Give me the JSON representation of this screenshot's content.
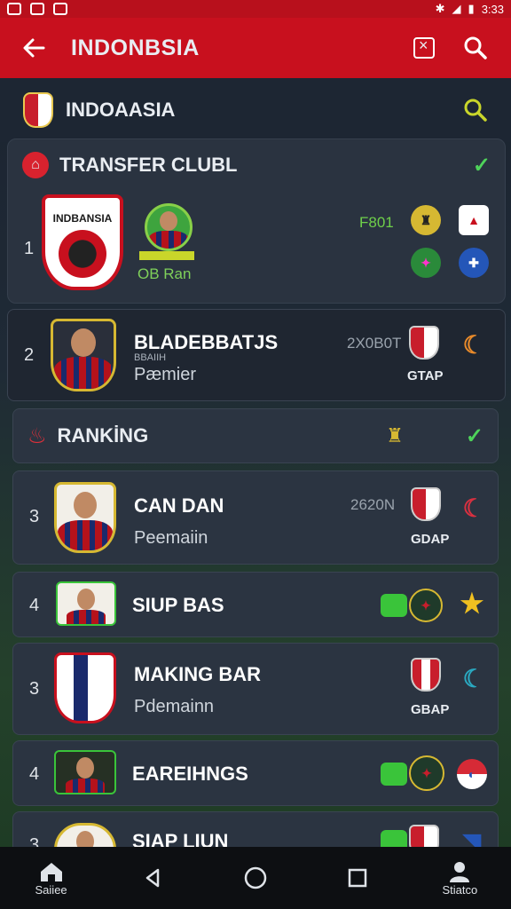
{
  "status_bar": {
    "time": "3:33"
  },
  "app_bar": {
    "title": "INDONBSIA"
  },
  "sub_header": {
    "team_name": "INDOAASIA"
  },
  "transfer_section": {
    "title": "TRANSFER CLUBL",
    "entries": [
      {
        "rank": "1",
        "crest_text": "INDBANSIA",
        "caption": "OB Ran",
        "points": "F801"
      },
      {
        "rank": "2",
        "name": "BLADEBBATJS",
        "small": "BBAIIH",
        "position": "Pæmier",
        "points": "2X0B0T",
        "label": "GTAP"
      }
    ]
  },
  "ranking_section": {
    "title": "RANKİNG",
    "entries": [
      {
        "rank": "3",
        "name": "CAN DAN",
        "position": "Peemaiin",
        "points": "2620N",
        "label": "GDAP"
      },
      {
        "rank": "4",
        "name": "SIUP BAS"
      },
      {
        "rank": "3",
        "name": "MAKING BAR",
        "position": "Pdemainn",
        "label": "GBAP"
      },
      {
        "rank": "4",
        "name": "EAREIHNGS"
      },
      {
        "rank": "3",
        "name": "SIAP LIUN"
      }
    ]
  },
  "bottom_nav": {
    "left_label": "Saiiee",
    "right_label": "Stiatco"
  },
  "colors": {
    "brand_red": "#c8101e",
    "accent_green": "#4ed35a",
    "card_bg": "#2b3441"
  }
}
